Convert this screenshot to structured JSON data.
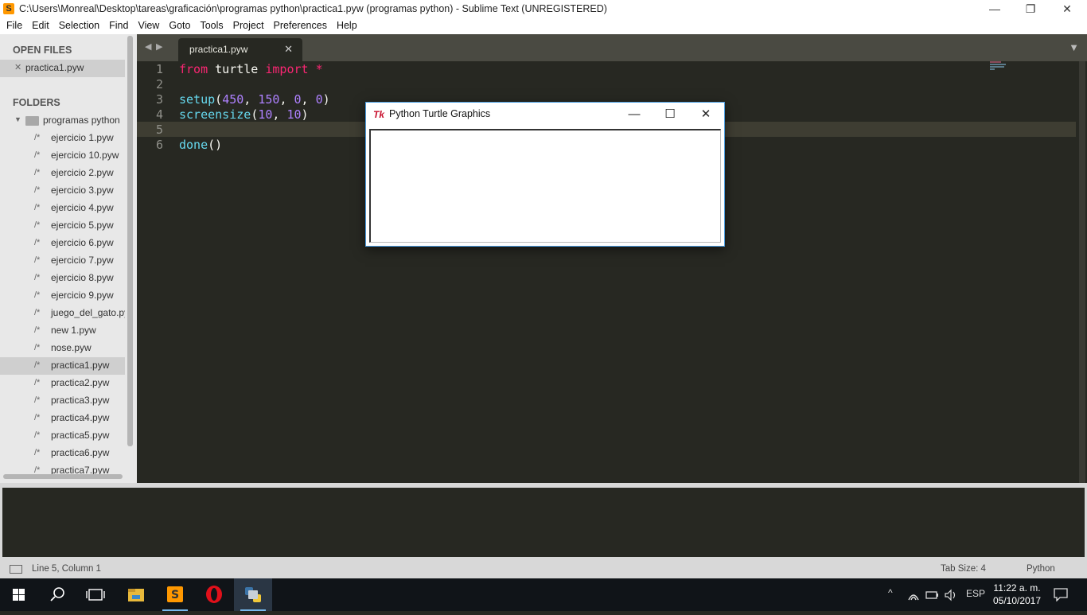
{
  "window": {
    "title": "C:\\Users\\Monreal\\Desktop\\tareas\\graficación\\programas python\\practica1.pyw (programas python) - Sublime Text (UNREGISTERED)",
    "app_icon": "S",
    "controls": {
      "minimize": "—",
      "restore": "❐",
      "close": "✕"
    }
  },
  "menu": [
    "File",
    "Edit",
    "Selection",
    "Find",
    "View",
    "Goto",
    "Tools",
    "Project",
    "Preferences",
    "Help"
  ],
  "sidebar": {
    "open_files_heading": "OPEN FILES",
    "open_files": [
      {
        "label": "practica1.pyw",
        "close": "✕"
      }
    ],
    "folders_heading": "FOLDERS",
    "folder": {
      "arrow": "▼",
      "name": "programas python"
    },
    "file_prefix": "/*",
    "files": [
      "ejercicio 1.pyw",
      "ejercicio 10.pyw",
      "ejercicio 2.pyw",
      "ejercicio 3.pyw",
      "ejercicio 4.pyw",
      "ejercicio 5.pyw",
      "ejercicio 6.pyw",
      "ejercicio 7.pyw",
      "ejercicio 8.pyw",
      "ejercicio 9.pyw",
      "juego_del_gato.py",
      "new 1.pyw",
      "nose.pyw",
      "practica1.pyw",
      "practica2.pyw",
      "practica3.pyw",
      "practica4.pyw",
      "practica5.pyw",
      "practica6.pyw",
      "practica7.pyw"
    ],
    "selected_file": "practica1.pyw"
  },
  "tabs": {
    "nav_left": "◀",
    "nav_right": "▶",
    "active": {
      "label": "practica1.pyw",
      "close": "✕"
    },
    "dropdown": "▼"
  },
  "editor": {
    "current_line": 5,
    "lines": [
      {
        "n": "1",
        "tokens": [
          {
            "t": "from",
            "c": "kw"
          },
          {
            "t": " turtle ",
            "c": ""
          },
          {
            "t": "import",
            "c": "kw"
          },
          {
            "t": " ",
            "c": ""
          },
          {
            "t": "*",
            "c": "kw"
          }
        ]
      },
      {
        "n": "2",
        "tokens": []
      },
      {
        "n": "3",
        "tokens": [
          {
            "t": "setup",
            "c": "fn"
          },
          {
            "t": "(",
            "c": ""
          },
          {
            "t": "450",
            "c": "num"
          },
          {
            "t": ", ",
            "c": ""
          },
          {
            "t": "150",
            "c": "num"
          },
          {
            "t": ", ",
            "c": ""
          },
          {
            "t": "0",
            "c": "num"
          },
          {
            "t": ", ",
            "c": ""
          },
          {
            "t": "0",
            "c": "num"
          },
          {
            "t": ")",
            "c": ""
          }
        ]
      },
      {
        "n": "4",
        "tokens": [
          {
            "t": "screensize",
            "c": "fn"
          },
          {
            "t": "(",
            "c": ""
          },
          {
            "t": "10",
            "c": "num"
          },
          {
            "t": ", ",
            "c": ""
          },
          {
            "t": "10",
            "c": "num"
          },
          {
            "t": ")",
            "c": ""
          }
        ]
      },
      {
        "n": "5",
        "tokens": []
      },
      {
        "n": "6",
        "tokens": [
          {
            "t": "done",
            "c": "fn"
          },
          {
            "t": "()",
            "c": ""
          }
        ]
      }
    ]
  },
  "turtle_window": {
    "icon": "Tk",
    "title": "Python Turtle Graphics",
    "controls": {
      "minimize": "—",
      "maximize": "☐",
      "close": "✕"
    }
  },
  "statusbar": {
    "position": "Line 5, Column 1",
    "tab_size": "Tab Size: 4",
    "syntax": "Python"
  },
  "taskbar": {
    "apps": [
      "windows-start",
      "search",
      "task-view",
      "file-explorer",
      "sublime-text",
      "opera",
      "python"
    ],
    "active_app": "python",
    "tray": {
      "chevron": "^",
      "language": "ESP",
      "time": "11:22 a. m.",
      "date": "05/10/2017"
    }
  },
  "colors": {
    "editor_bg": "#272822",
    "keyword": "#f92672",
    "function": "#66d9ef",
    "number": "#ae81ff",
    "text": "#f8f8f2"
  }
}
